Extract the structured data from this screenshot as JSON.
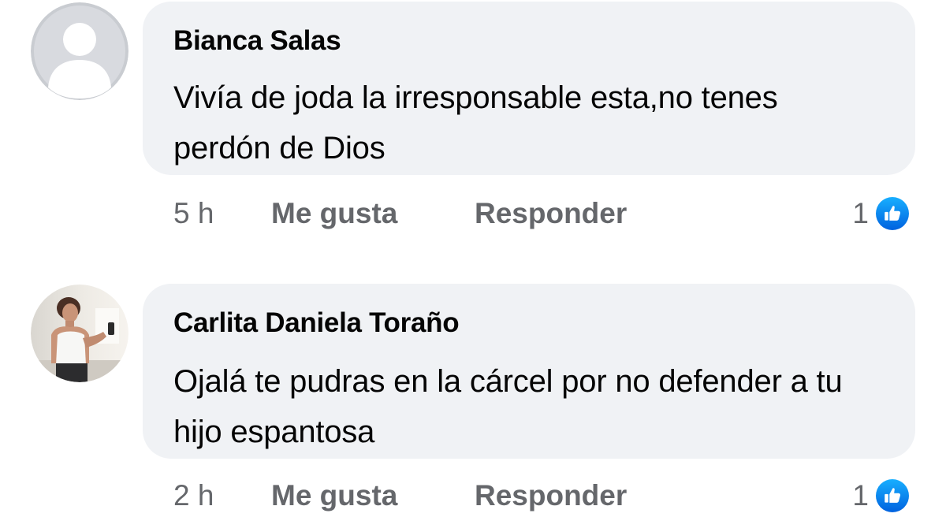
{
  "comments": [
    {
      "author": "Bianca Salas",
      "text": "Vivía de joda la irresponsable esta,no tenes perdón de Dios",
      "time": "5 h",
      "like_label": "Me gusta",
      "reply_label": "Responder",
      "reaction_count": "1",
      "reaction_icon": "thumbs-up-icon",
      "avatar": "default-silhouette"
    },
    {
      "author": "Carlita Daniela Toraño",
      "text": "Ojalá te pudras en la cárcel por no defender a tu hijo espantosa",
      "time": "2 h",
      "like_label": "Me gusta",
      "reply_label": "Responder",
      "reaction_count": "1",
      "reaction_icon": "thumbs-up-icon",
      "avatar": "photo"
    }
  ],
  "colors": {
    "bubble_bg": "#f0f2f5",
    "meta_text": "#65676b",
    "like_blue": "#1877f2"
  }
}
